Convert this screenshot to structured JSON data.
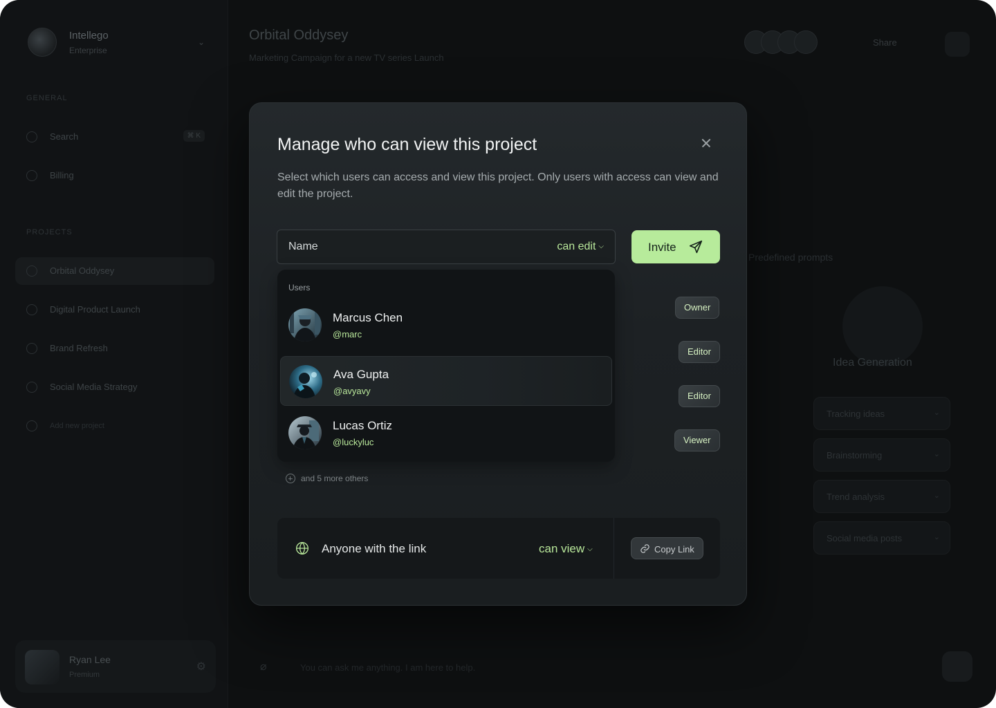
{
  "background": {
    "workspace": {
      "name": "Intellego",
      "subtitle": "Enterprise"
    },
    "sidebar": {
      "general_label": "GENERAL",
      "items": [
        {
          "label": "Search",
          "shortcut": "⌘ K"
        },
        {
          "label": "Billing"
        }
      ],
      "projects_label": "PROJECTS",
      "projects": [
        {
          "label": "Orbital Oddysey"
        },
        {
          "label": "Digital Product Launch"
        },
        {
          "label": "Brand Refresh"
        },
        {
          "label": "Social Media Strategy"
        },
        {
          "label": "Add new project"
        }
      ],
      "user": {
        "name": "Ryan Lee",
        "plan": "Premium"
      }
    },
    "header": {
      "title": "Orbital Oddysey",
      "subtitle": "Marketing Campaign for a new TV series Launch",
      "share_label": "Share"
    },
    "right_panel": {
      "idea_title": "Idea Generation",
      "prompt_hint": "Predefined prompts",
      "items": [
        "Tracking ideas",
        "Brainstorming",
        "Trend analysis",
        "Social media posts"
      ]
    },
    "composer_placeholder": "You can ask me anything. I am here to help."
  },
  "modal": {
    "title": "Manage who can view this project",
    "description": "Select which users can access and view this project. Only users with access can view and edit the project.",
    "name_placeholder": "Name",
    "permission": "can edit",
    "invite_label": "Invite",
    "users_label": "Users",
    "users": [
      {
        "name": "Marcus Chen",
        "handle": "@marc",
        "role": "Owner"
      },
      {
        "name": "Ava Gupta",
        "handle": "@avyavy",
        "role": "Editor"
      },
      {
        "name": "Lucas Ortiz",
        "handle": "@luckyluc",
        "role": "Viewer"
      }
    ],
    "more_others": "and 5 more others",
    "link_access": {
      "label": "Anyone with the link",
      "permission": "can view",
      "copy_label": "Copy Link"
    },
    "colors": {
      "accent": "#b7eb9b",
      "modal_bg": "#1d2124"
    }
  },
  "icons": [
    "close-icon",
    "chevron-down-icon",
    "send-icon",
    "plus-circle-icon",
    "globe-icon",
    "link-icon"
  ]
}
